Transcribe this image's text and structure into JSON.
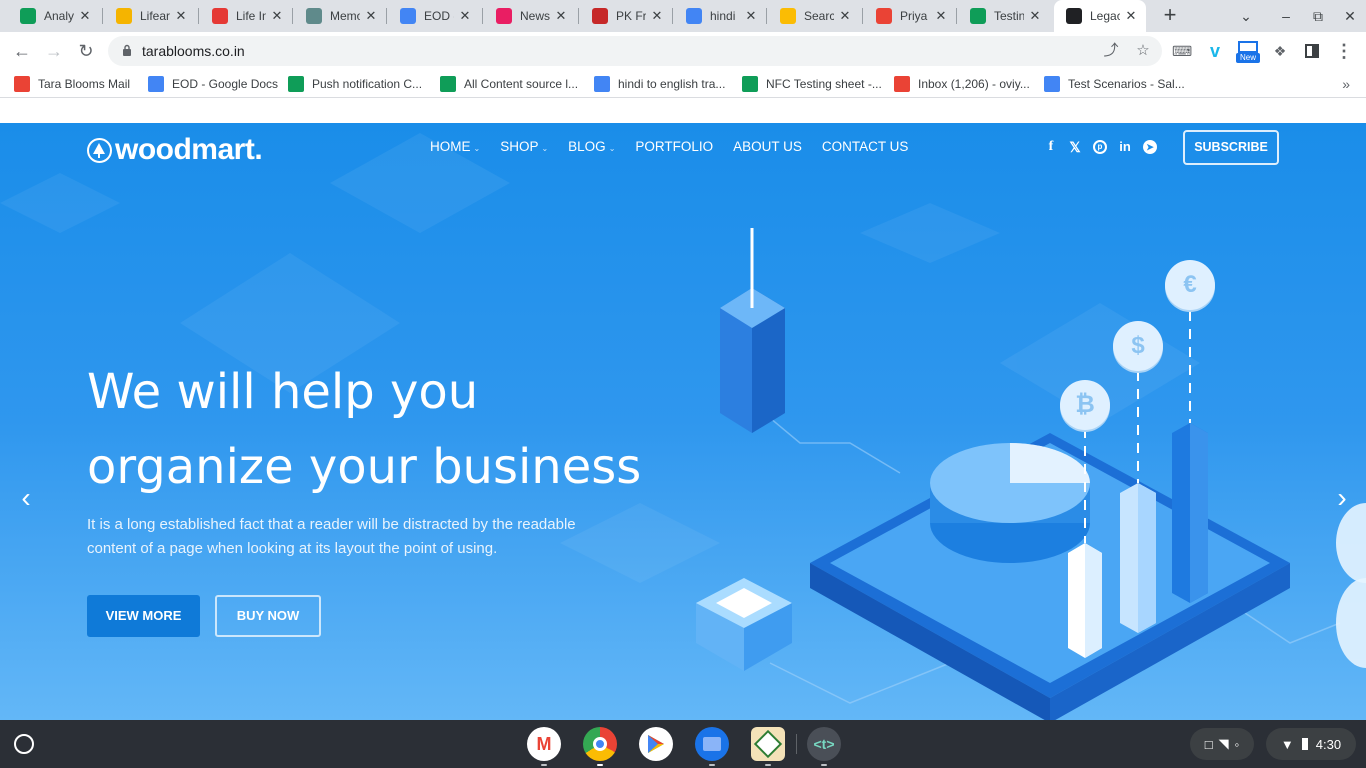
{
  "browser": {
    "tabs": [
      {
        "label": "Analy",
        "icon": "sheets-icon",
        "color": "#0f9d58"
      },
      {
        "label": "Lifear",
        "icon": "lifeart-icon",
        "color": "#f5b400"
      },
      {
        "label": "Life In",
        "icon": "pinwheel-icon",
        "color": "#e53935"
      },
      {
        "label": "Memo",
        "icon": "memo-icon",
        "color": "#5f8a8b"
      },
      {
        "label": "EOD -",
        "icon": "docs-icon",
        "color": "#4285f4"
      },
      {
        "label": "News",
        "icon": "flower-icon",
        "color": "#e91e63"
      },
      {
        "label": "PK Fr",
        "icon": "pk-icon",
        "color": "#c62828"
      },
      {
        "label": "hindi",
        "icon": "google-icon",
        "color": "#4285f4"
      },
      {
        "label": "Searc",
        "icon": "drive-icon",
        "color": "#fbbc04"
      },
      {
        "label": "Priya",
        "icon": "gmail-icon",
        "color": "#ea4335"
      },
      {
        "label": "Testin",
        "icon": "sheets-icon",
        "color": "#0f9d58"
      },
      {
        "label": "Legac",
        "icon": "woodmart-icon",
        "color": "#202124",
        "active": true
      }
    ],
    "url": "tarablooms.co.in",
    "extension_badge": "New"
  },
  "bookmarks": [
    {
      "label": "Tara Blooms Mail",
      "icon": "gmail-icon",
      "color": "#ea4335"
    },
    {
      "label": "EOD - Google Docs",
      "icon": "docs-icon",
      "color": "#4285f4"
    },
    {
      "label": "Push notification C...",
      "icon": "sheets-icon",
      "color": "#0f9d58"
    },
    {
      "label": "All Content source l...",
      "icon": "sheets-icon",
      "color": "#0f9d58"
    },
    {
      "label": "hindi to english tra...",
      "icon": "google-icon",
      "color": "#4285f4"
    },
    {
      "label": "NFC Testing sheet -...",
      "icon": "sheets-icon",
      "color": "#0f9d58"
    },
    {
      "label": "Inbox (1,206) - oviy...",
      "icon": "gmail-icon",
      "color": "#ea4335"
    },
    {
      "label": "Test Scenarios - Sal...",
      "icon": "docs-icon",
      "color": "#4285f4"
    }
  ],
  "site": {
    "logo": "woodmart.",
    "nav": [
      {
        "label": "HOME",
        "dropdown": true
      },
      {
        "label": "SHOP",
        "dropdown": true
      },
      {
        "label": "BLOG",
        "dropdown": true
      },
      {
        "label": "PORTFOLIO",
        "dropdown": false
      },
      {
        "label": "ABOUT US",
        "dropdown": false
      },
      {
        "label": "CONTACT US",
        "dropdown": false
      }
    ],
    "social": [
      "facebook-icon",
      "x-icon",
      "pinterest-icon",
      "linkedin-icon",
      "telegram-icon"
    ],
    "subscribe": "SUBSCRIBE",
    "hero": {
      "headline_1": "We will help you",
      "headline_2": "organize your business",
      "text": "It is a long established fact that a reader will be distracted by the readable content of a page when looking at its layout the point of using.",
      "primary_button": "VIEW MORE",
      "secondary_button": "BUY NOW",
      "coins": [
        "₿",
        "$",
        "€"
      ]
    },
    "colors": {
      "hero_top": "#1a8de9",
      "hero_bottom": "#63b7f7",
      "button": "#0f7ad8"
    }
  },
  "shelf": {
    "apps": [
      "gmail-icon",
      "chrome-icon",
      "play-store-icon",
      "files-icon",
      "mahjong-icon",
      "terminal-icon"
    ],
    "terminal_label": "<t>",
    "time": "4:30"
  }
}
